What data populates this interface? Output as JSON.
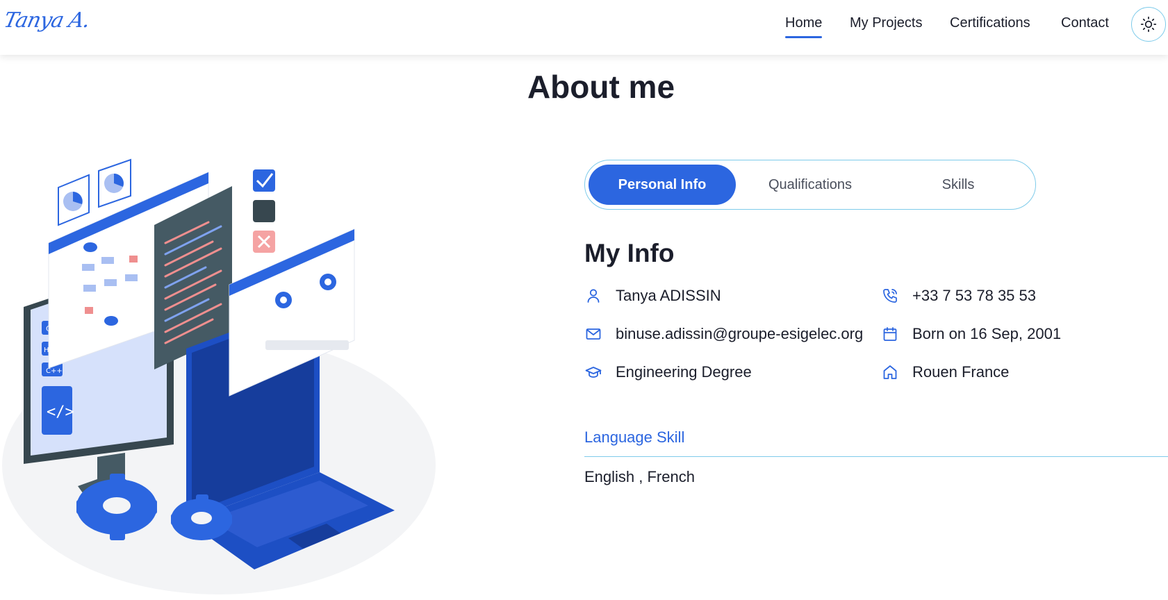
{
  "nav": {
    "logo": "Tanya A.",
    "links": [
      {
        "label": "Home",
        "active": true
      },
      {
        "label": "My Projects",
        "active": false
      },
      {
        "label": "Certifications",
        "active": false
      },
      {
        "label": "Contact",
        "active": false
      }
    ],
    "theme_icon": "sun-icon"
  },
  "about": {
    "title": "About me"
  },
  "tabs": [
    {
      "label": "Personal Info",
      "active": true
    },
    {
      "label": "Qualifications",
      "active": false
    },
    {
      "label": "Skills",
      "active": false
    }
  ],
  "info": {
    "title": "My Info",
    "items": [
      {
        "icon": "user-icon",
        "text": "Tanya ADISSIN"
      },
      {
        "icon": "phone-icon",
        "text": "+33 7 53 78 35 53"
      },
      {
        "icon": "mail-icon",
        "text": "binuse.adissin@groupe-esigelec.org"
      },
      {
        "icon": "calendar-icon",
        "text": "Born on 16 Sep, 2001"
      },
      {
        "icon": "graduation-cap-icon",
        "text": "Engineering Degree"
      },
      {
        "icon": "home-icon",
        "text": "Rouen France"
      }
    ]
  },
  "language": {
    "title": "Language Skill",
    "value": "English , French"
  },
  "colors": {
    "accent": "#2c66e0",
    "border": "#7ecbea",
    "text": "#1b1e2b"
  }
}
